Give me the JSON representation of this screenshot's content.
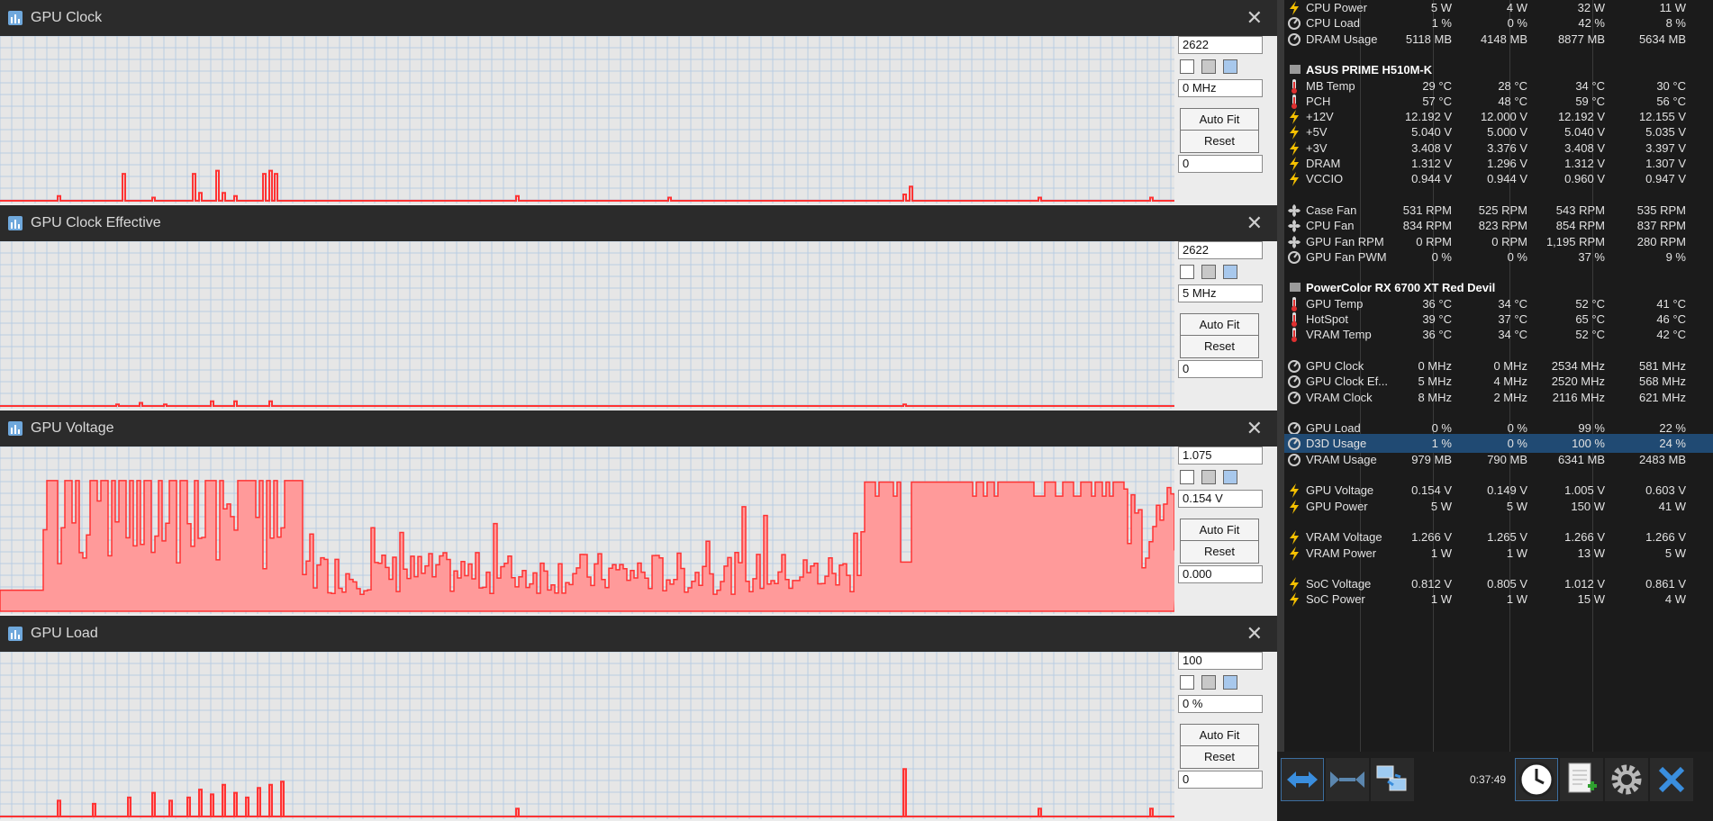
{
  "graphs": [
    {
      "title": "GPU Clock",
      "max_field": "2622",
      "current_field": "0 MHz",
      "min_field": "0",
      "auto_fit_label": "Auto Fit",
      "reset_label": "Reset",
      "y_max": 2622,
      "series_color": "#ff3333",
      "fill": false,
      "spikes": [
        [
          0.05,
          0.03
        ],
        [
          0.105,
          0.17
        ],
        [
          0.13,
          0.02
        ],
        [
          0.165,
          0.17
        ],
        [
          0.17,
          0.05
        ],
        [
          0.185,
          0.19
        ],
        [
          0.19,
          0.05
        ],
        [
          0.2,
          0.03
        ],
        [
          0.225,
          0.17
        ],
        [
          0.23,
          0.19
        ],
        [
          0.235,
          0.17
        ],
        [
          0.44,
          0.03
        ],
        [
          0.57,
          0.02
        ],
        [
          0.77,
          0.04
        ],
        [
          0.775,
          0.09
        ],
        [
          0.885,
          0.02
        ],
        [
          0.98,
          0.02
        ]
      ]
    },
    {
      "title": "GPU Clock Effective",
      "max_field": "2622",
      "current_field": "5 MHz",
      "min_field": "0",
      "auto_fit_label": "Auto Fit",
      "reset_label": "Reset",
      "y_max": 2622,
      "series_color": "#ff3333",
      "fill": false,
      "spikes": [
        [
          0.1,
          0.01
        ],
        [
          0.12,
          0.02
        ],
        [
          0.14,
          0.01
        ],
        [
          0.18,
          0.03
        ],
        [
          0.2,
          0.03
        ],
        [
          0.23,
          0.03
        ],
        [
          0.77,
          0.01
        ]
      ]
    },
    {
      "title": "GPU Voltage",
      "max_field": "1.075",
      "current_field": "0.154 V",
      "min_field": "0.000",
      "auto_fit_label": "Auto Fit",
      "reset_label": "Reset",
      "y_max": 1.075,
      "series_color": "#ff3333",
      "fill": true,
      "voltage": true
    },
    {
      "title": "GPU Load",
      "max_field": "100",
      "current_field": "0 %",
      "min_field": "0",
      "auto_fit_label": "Auto Fit",
      "reset_label": "Reset",
      "y_max": 100,
      "series_color": "#ff3333",
      "fill": true,
      "spikes": [
        [
          0.05,
          0.1
        ],
        [
          0.08,
          0.08
        ],
        [
          0.11,
          0.12
        ],
        [
          0.13,
          0.15
        ],
        [
          0.145,
          0.1
        ],
        [
          0.16,
          0.12
        ],
        [
          0.17,
          0.17
        ],
        [
          0.18,
          0.14
        ],
        [
          0.19,
          0.2
        ],
        [
          0.2,
          0.15
        ],
        [
          0.21,
          0.12
        ],
        [
          0.22,
          0.18
        ],
        [
          0.23,
          0.2
        ],
        [
          0.24,
          0.22
        ],
        [
          0.44,
          0.05
        ],
        [
          0.77,
          0.3
        ],
        [
          0.885,
          0.05
        ],
        [
          0.98,
          0.05
        ]
      ]
    }
  ],
  "sensor_rows": [
    {
      "label": "CPU Power",
      "icon": "bolt",
      "cur": "5 W",
      "min": "4 W",
      "max": "32 W",
      "avg": "11 W"
    },
    {
      "label": "CPU Load",
      "icon": "gauge",
      "cur": "1 %",
      "min": "0 %",
      "max": "42 %",
      "avg": "8 %"
    },
    {
      "label": "DRAM Usage",
      "icon": "gauge",
      "cur": "5118 MB",
      "min": "4148 MB",
      "max": "8877 MB",
      "avg": "5634 MB"
    },
    {
      "blank": true
    },
    {
      "group": "ASUS PRIME H510M-K"
    },
    {
      "label": "MB Temp",
      "icon": "temp",
      "cur": "29 °C",
      "min": "28 °C",
      "max": "34 °C",
      "avg": "30 °C"
    },
    {
      "label": "PCH",
      "icon": "temp",
      "cur": "57 °C",
      "min": "48 °C",
      "max": "59 °C",
      "avg": "56 °C"
    },
    {
      "label": "+12V",
      "icon": "bolt",
      "cur": "12.192 V",
      "min": "12.000 V",
      "max": "12.192 V",
      "avg": "12.155 V"
    },
    {
      "label": "+5V",
      "icon": "bolt",
      "cur": "5.040 V",
      "min": "5.000 V",
      "max": "5.040 V",
      "avg": "5.035 V"
    },
    {
      "label": "+3V",
      "icon": "bolt",
      "cur": "3.408 V",
      "min": "3.376 V",
      "max": "3.408 V",
      "avg": "3.397 V"
    },
    {
      "label": "DRAM",
      "icon": "bolt",
      "cur": "1.312 V",
      "min": "1.296 V",
      "max": "1.312 V",
      "avg": "1.307 V"
    },
    {
      "label": "VCCIO",
      "icon": "bolt",
      "cur": "0.944 V",
      "min": "0.944 V",
      "max": "0.960 V",
      "avg": "0.947 V"
    },
    {
      "blank": true
    },
    {
      "label": "Case Fan",
      "icon": "fan",
      "cur": "531 RPM",
      "min": "525 RPM",
      "max": "543 RPM",
      "avg": "535 RPM"
    },
    {
      "label": "CPU Fan",
      "icon": "fan",
      "cur": "834 RPM",
      "min": "823 RPM",
      "max": "854 RPM",
      "avg": "837 RPM"
    },
    {
      "label": "GPU Fan RPM",
      "icon": "fan",
      "cur": "0 RPM",
      "min": "0 RPM",
      "max": "1,195 RPM",
      "avg": "280 RPM"
    },
    {
      "label": "GPU Fan PWM",
      "icon": "gauge",
      "cur": "0 %",
      "min": "0 %",
      "max": "37 %",
      "avg": "9 %"
    },
    {
      "blank": true
    },
    {
      "group": "PowerColor RX 6700 XT Red Devil"
    },
    {
      "label": "GPU Temp",
      "icon": "temp",
      "cur": "36 °C",
      "min": "34 °C",
      "max": "52 °C",
      "avg": "41 °C"
    },
    {
      "label": "HotSpot",
      "icon": "temp",
      "cur": "39 °C",
      "min": "37 °C",
      "max": "65 °C",
      "avg": "46 °C"
    },
    {
      "label": "VRAM Temp",
      "icon": "temp",
      "cur": "36 °C",
      "min": "34 °C",
      "max": "52 °C",
      "avg": "42 °C"
    },
    {
      "blank": true
    },
    {
      "label": "GPU Clock",
      "icon": "gauge",
      "cur": "0 MHz",
      "min": "0 MHz",
      "max": "2534 MHz",
      "avg": "581 MHz"
    },
    {
      "label": "GPU Clock Ef...",
      "icon": "gauge",
      "cur": "5 MHz",
      "min": "4 MHz",
      "max": "2520 MHz",
      "avg": "568 MHz"
    },
    {
      "label": "VRAM Clock",
      "icon": "gauge",
      "cur": "8 MHz",
      "min": "2 MHz",
      "max": "2116 MHz",
      "avg": "621 MHz"
    },
    {
      "blank": true
    },
    {
      "label": "GPU Load",
      "icon": "gauge",
      "cur": "0 %",
      "min": "0 %",
      "max": "99 %",
      "avg": "22 %"
    },
    {
      "label": "D3D Usage",
      "icon": "gauge",
      "cur": "1 %",
      "min": "0 %",
      "max": "100 %",
      "avg": "24 %",
      "selected": true
    },
    {
      "label": "VRAM Usage",
      "icon": "gauge",
      "cur": "979 MB",
      "min": "790 MB",
      "max": "6341 MB",
      "avg": "2483 MB"
    },
    {
      "blank": true
    },
    {
      "label": "GPU Voltage",
      "icon": "bolt",
      "cur": "0.154 V",
      "min": "0.149 V",
      "max": "1.005 V",
      "avg": "0.603 V"
    },
    {
      "label": "GPU Power",
      "icon": "bolt",
      "cur": "5 W",
      "min": "5 W",
      "max": "150 W",
      "avg": "41 W"
    },
    {
      "blank": true
    },
    {
      "label": "VRAM Voltage",
      "icon": "bolt",
      "cur": "1.266 V",
      "min": "1.265 V",
      "max": "1.266 V",
      "avg": "1.266 V"
    },
    {
      "label": "VRAM Power",
      "icon": "bolt",
      "cur": "1 W",
      "min": "1 W",
      "max": "13 W",
      "avg": "5 W"
    },
    {
      "blank": true
    },
    {
      "label": "SoC Voltage",
      "icon": "bolt",
      "cur": "0.812 V",
      "min": "0.805 V",
      "max": "1.012 V",
      "avg": "0.861 V"
    },
    {
      "label": "SoC Power",
      "icon": "bolt",
      "cur": "1 W",
      "min": "1 W",
      "max": "15 W",
      "avg": "4 W"
    }
  ],
  "toolbar": {
    "timer": "0:37:49"
  },
  "colors": {
    "accent": "#3c6ea0",
    "series": "#ff3333",
    "fill": "#ff9a9a",
    "bolt": "#f5c000",
    "temp": "#e03030",
    "selected_row": "#204a73"
  }
}
